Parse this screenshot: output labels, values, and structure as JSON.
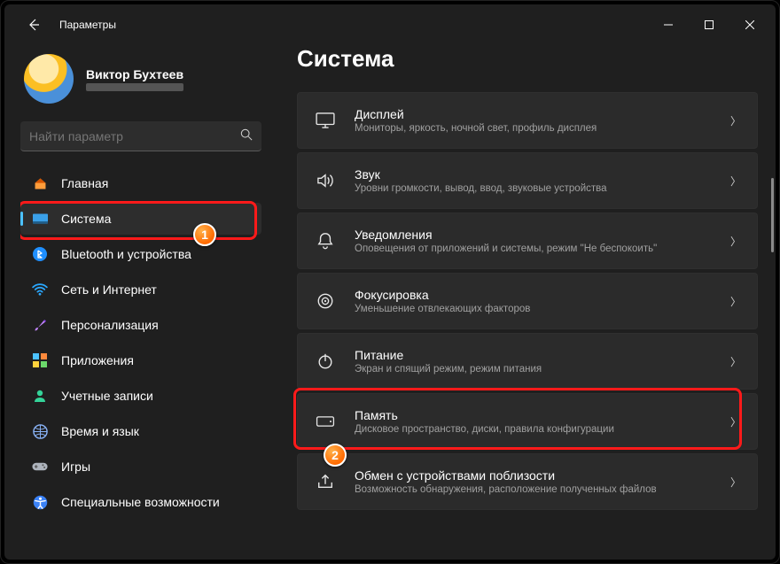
{
  "titlebar": {
    "appname": "Параметры"
  },
  "profile": {
    "username": "Виктор Бухтеев"
  },
  "search": {
    "placeholder": "Найти параметр"
  },
  "nav": [
    {
      "id": "home",
      "label": "Главная"
    },
    {
      "id": "system",
      "label": "Система",
      "selected": true
    },
    {
      "id": "bluetooth",
      "label": "Bluetooth и устройства"
    },
    {
      "id": "network",
      "label": "Сеть и Интернет"
    },
    {
      "id": "personalization",
      "label": "Персонализация"
    },
    {
      "id": "apps",
      "label": "Приложения"
    },
    {
      "id": "accounts",
      "label": "Учетные записи"
    },
    {
      "id": "time",
      "label": "Время и язык"
    },
    {
      "id": "gaming",
      "label": "Игры"
    },
    {
      "id": "accessibility",
      "label": "Специальные возможности"
    }
  ],
  "main": {
    "heading": "Система",
    "settings": [
      {
        "id": "display",
        "title": "Дисплей",
        "sub": "Мониторы, яркость, ночной свет, профиль дисплея"
      },
      {
        "id": "sound",
        "title": "Звук",
        "sub": "Уровни громкости, вывод, ввод, звуковые устройства"
      },
      {
        "id": "notif",
        "title": "Уведомления",
        "sub": "Оповещения от приложений и системы, режим \"Не беспокоить\""
      },
      {
        "id": "focus",
        "title": "Фокусировка",
        "sub": "Уменьшение отвлекающих факторов"
      },
      {
        "id": "power",
        "title": "Питание",
        "sub": "Экран и спящий режим, режим питания"
      },
      {
        "id": "storage",
        "title": "Память",
        "sub": "Дисковое пространство, диски, правила конфигурации"
      },
      {
        "id": "share",
        "title": "Обмен с устройствами поблизости",
        "sub": "Возможность обнаружения, расположение полученных файлов"
      }
    ]
  },
  "annotations": {
    "badge1": "1",
    "badge2": "2"
  },
  "colors": {
    "accent": "#4cc2ff",
    "highlight": "#ff1a1a",
    "badge": "#ff6a00"
  }
}
